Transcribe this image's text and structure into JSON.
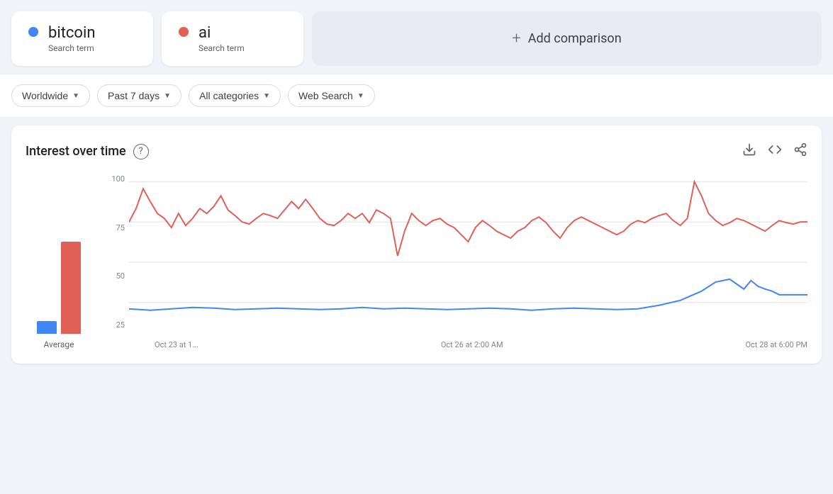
{
  "terms": [
    {
      "id": "bitcoin",
      "name": "bitcoin",
      "type": "Search term",
      "dot_color": "blue"
    },
    {
      "id": "ai",
      "name": "ai",
      "type": "Search term",
      "dot_color": "red"
    }
  ],
  "add_comparison_label": "Add comparison",
  "filters": {
    "region": "Worldwide",
    "period": "Past 7 days",
    "category": "All categories",
    "search_type": "Web Search"
  },
  "chart": {
    "title": "Interest over time",
    "help_icon": "?",
    "actions": {
      "download": "download-icon",
      "embed": "embed-icon",
      "share": "share-icon"
    },
    "y_labels": [
      "100",
      "75",
      "50",
      "25"
    ],
    "x_labels": [
      "Oct 23 at 1...",
      "Oct 26 at 2:00 AM",
      "Oct 28 at 6:00 PM"
    ],
    "avg_label": "Average",
    "avg_bar_blue_height": 18,
    "avg_bar_red_height": 130,
    "colors": {
      "bitcoin_line": "#e06055",
      "ai_line": "#4285f4",
      "grid": "#e0e0e0"
    }
  }
}
